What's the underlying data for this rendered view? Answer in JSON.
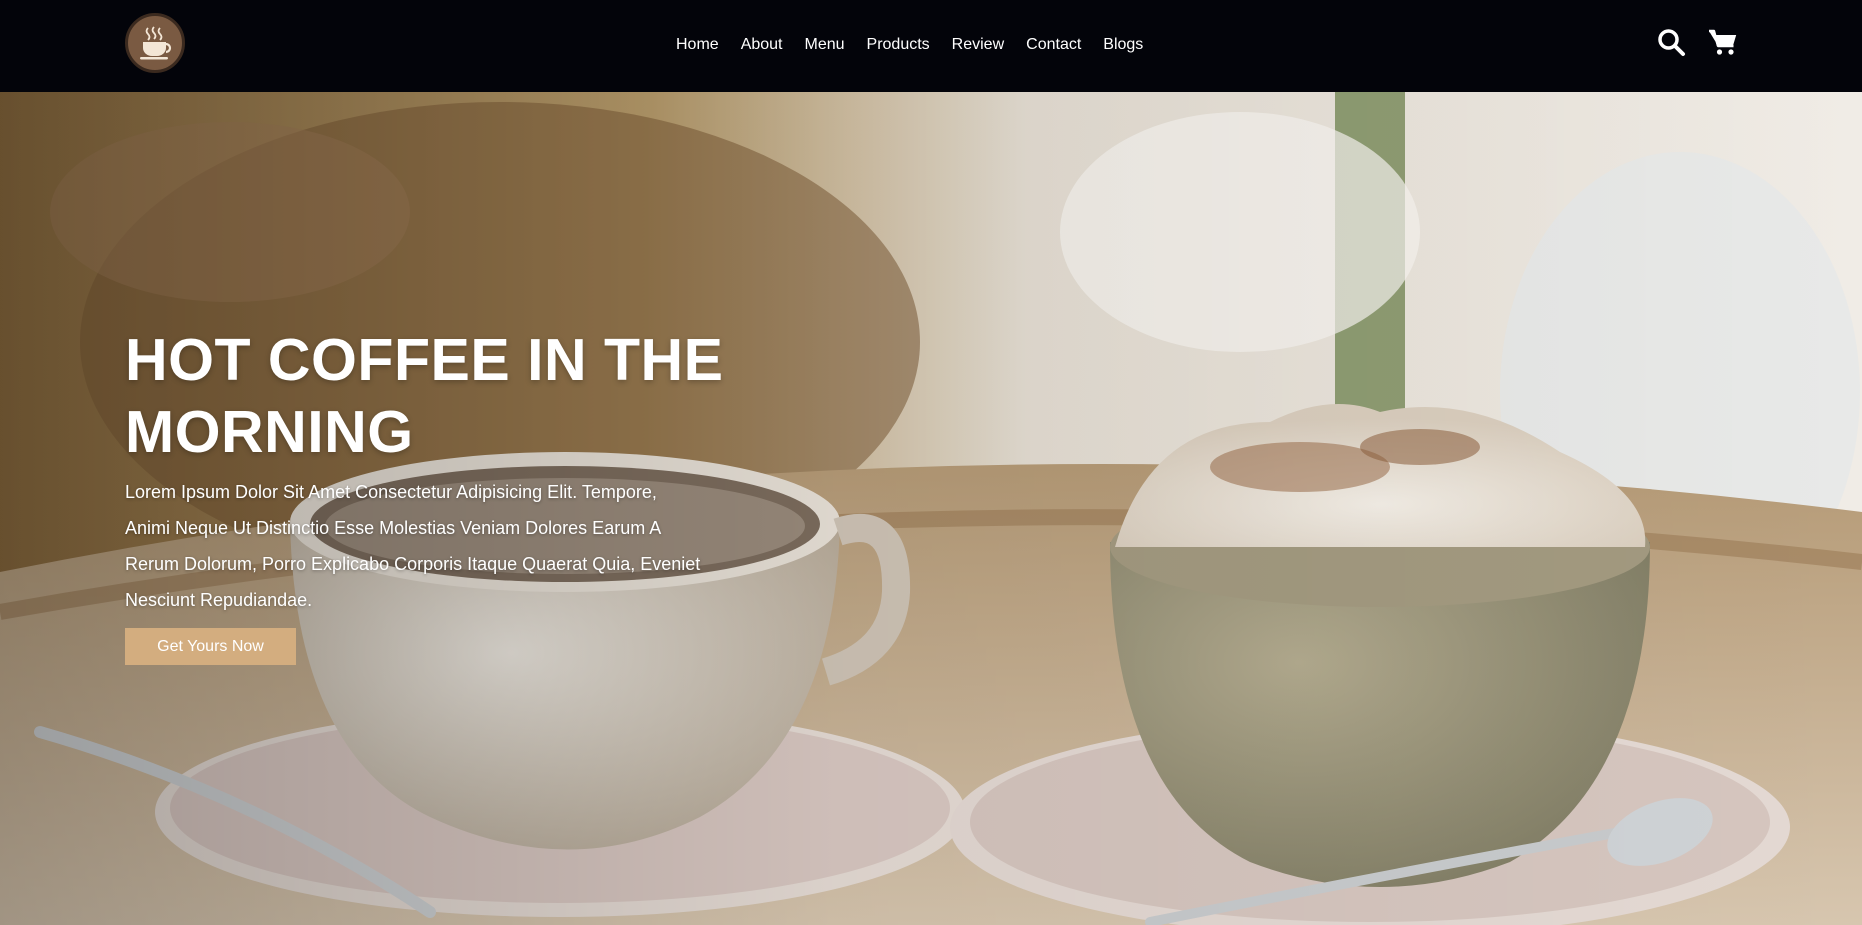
{
  "header": {
    "logo_icon": "coffee-cup-icon",
    "nav": [
      "Home",
      "About",
      "Menu",
      "Products",
      "Review",
      "Contact",
      "Blogs"
    ],
    "icons": [
      "search-icon",
      "cart-icon"
    ]
  },
  "hero": {
    "title_line1": "HOT COFFEE IN THE",
    "title_line2": "MORNING",
    "description": "Lorem Ipsum Dolor Sit Amet Consectetur Adipisicing Elit. Tempore, Animi Neque Ut Distinctio Esse Molestias Veniam Dolores Earum A Rerum Dolorum, Porro Explicabo Corporis Itaque Quaerat Quia, Eveniet Nesciunt Repudiandae.",
    "cta_label": "Get Yours Now",
    "background_description_icon": "coffee-cups-photo"
  },
  "colors": {
    "header_bg": "#03040a",
    "accent": "#d3ad7f",
    "text": "#ffffff"
  }
}
